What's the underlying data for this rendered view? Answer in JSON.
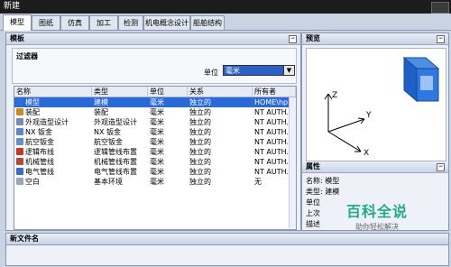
{
  "window": {
    "title": "新建"
  },
  "tabs": [
    "模型",
    "图纸",
    "仿真",
    "加工",
    "检测",
    "机电概念设计",
    "船舶结构"
  ],
  "template_section": {
    "title": "模板"
  },
  "filter": {
    "title": "过滤器",
    "unit_label": "单位",
    "unit_value": "毫米"
  },
  "table": {
    "headers": [
      "名称",
      "类型",
      "单位",
      "关系",
      "所有者"
    ],
    "rows": [
      {
        "name": "模型",
        "type": "建模",
        "unit": "毫米",
        "relation": "独立的",
        "owner": "HOME\\hp",
        "icon": "model-icon",
        "color": "#2e6fd8"
      },
      {
        "name": "装配",
        "type": "装配",
        "unit": "毫米",
        "relation": "独立的",
        "owner": "NT AUTH...",
        "icon": "assembly-icon",
        "color": "#c98a24"
      },
      {
        "name": "外观造型设计",
        "type": "外观造型设计",
        "unit": "毫米",
        "relation": "独立的",
        "owner": "NT AUTH...",
        "icon": "shape-studio-icon",
        "color": "#7a8bb0"
      },
      {
        "name": "NX 钣金",
        "type": "NX 钣金",
        "unit": "毫米",
        "relation": "独立的",
        "owner": "NT AUTH...",
        "icon": "sheet-metal-icon",
        "color": "#5c89c4"
      },
      {
        "name": "航空钣金",
        "type": "航空钣金",
        "unit": "毫米",
        "relation": "独立的",
        "owner": "NT AUTH...",
        "icon": "aero-sheet-metal-icon",
        "color": "#6a8fbf"
      },
      {
        "name": "逻辑布线",
        "type": "逻辑管线布置",
        "unit": "毫米",
        "relation": "独立的",
        "owner": "NT AUTH...",
        "icon": "logical-routing-icon",
        "color": "#c0392b"
      },
      {
        "name": "机械管线",
        "type": "机械管线布置",
        "unit": "毫米",
        "relation": "独立的",
        "owner": "NT AUTH...",
        "icon": "mechanical-routing-icon",
        "color": "#b34a3a"
      },
      {
        "name": "电气管线",
        "type": "电气管线布置",
        "unit": "毫米",
        "relation": "独立的",
        "owner": "NT AUTH...",
        "icon": "electrical-routing-icon",
        "color": "#3b6fbd"
      },
      {
        "name": "空白",
        "type": "基本环境",
        "unit": "毫米",
        "relation": "独立的",
        "owner": "无",
        "icon": "blank-icon",
        "color": "#9aa5b8"
      }
    ]
  },
  "preview": {
    "title": "预览",
    "axis_labels": [
      "Z",
      "Y",
      "X"
    ]
  },
  "properties": {
    "title": "属性",
    "lines": [
      "名称: 模型",
      "类型: 建模",
      "单位",
      "上次",
      "描述"
    ]
  },
  "watermark": {
    "line1": "百科全说",
    "line2": "助你轻松解决"
  },
  "new_file_name": {
    "title": "新文件名"
  },
  "colors": {
    "accent": "#2a6ad8",
    "titlebar": "#1c1c1c",
    "section": "#c8d3e6"
  }
}
